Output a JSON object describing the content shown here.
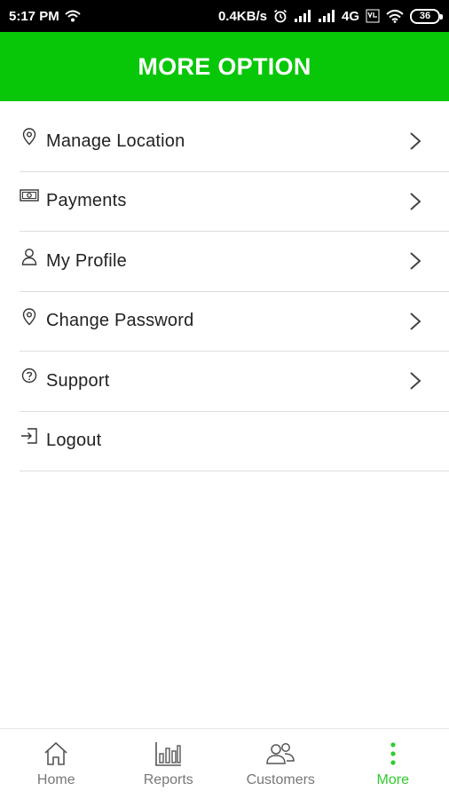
{
  "status_bar": {
    "time": "5:17 PM",
    "network_speed": "0.4KB/s",
    "network_type": "4G",
    "battery": "36"
  },
  "header": {
    "title": "MORE OPTION"
  },
  "menu": {
    "items": [
      {
        "label": "Manage Location",
        "icon": "location-pin-icon",
        "has_chevron": true
      },
      {
        "label": "Payments",
        "icon": "money-icon",
        "has_chevron": true
      },
      {
        "label": "My Profile",
        "icon": "person-icon",
        "has_chevron": true
      },
      {
        "label": "Change Password",
        "icon": "location-pin-icon",
        "has_chevron": true
      },
      {
        "label": "Support",
        "icon": "help-circle-icon",
        "has_chevron": true
      },
      {
        "label": "Logout",
        "icon": "logout-icon",
        "has_chevron": false
      }
    ]
  },
  "bottom_nav": {
    "items": [
      {
        "label": "Home",
        "icon": "home-icon",
        "active": false
      },
      {
        "label": "Reports",
        "icon": "bar-chart-icon",
        "active": false
      },
      {
        "label": "Customers",
        "icon": "people-icon",
        "active": false
      },
      {
        "label": "More",
        "icon": "more-vertical-icon",
        "active": true
      }
    ]
  },
  "colors": {
    "header_bg": "#08c608",
    "active_nav": "#2ecc2e",
    "status_bar_bg": "#000000"
  }
}
